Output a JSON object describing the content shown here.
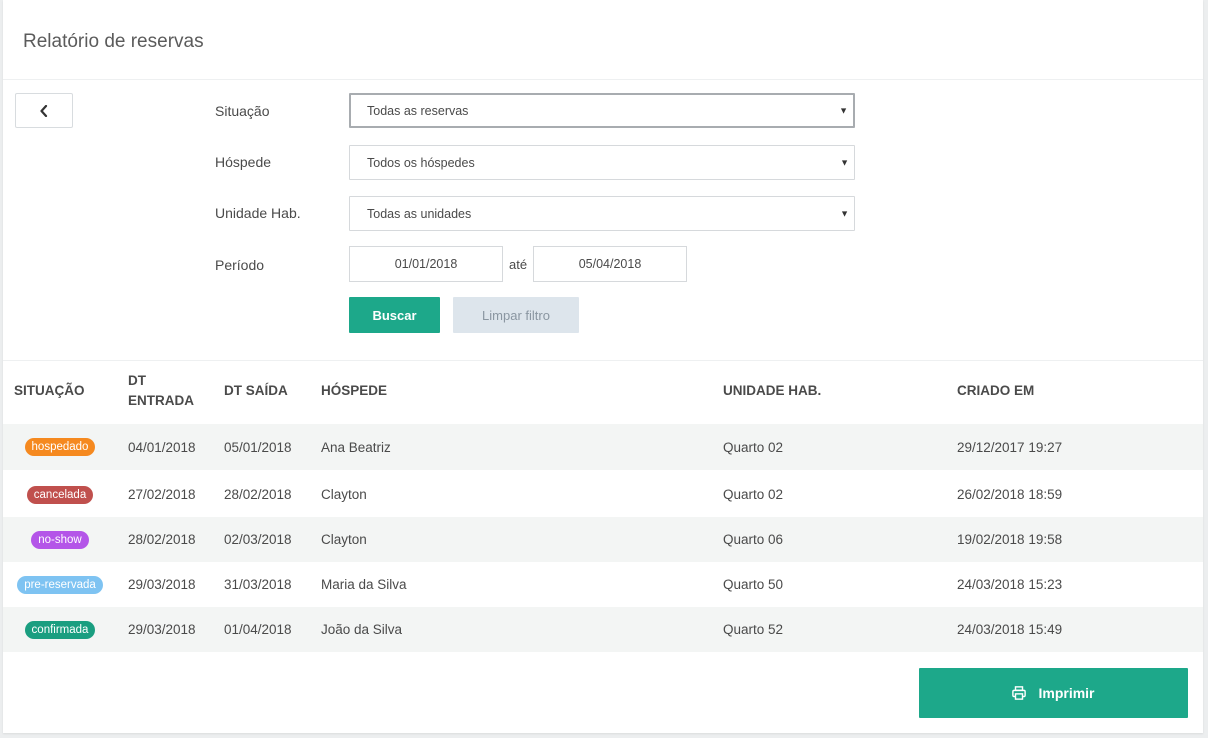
{
  "header": {
    "title": "Relatório de reservas"
  },
  "filters": {
    "situacao": {
      "label": "Situação",
      "value": "Todas as reservas"
    },
    "hospede": {
      "label": "Hóspede",
      "value": "Todos os hóspedes"
    },
    "unidade": {
      "label": "Unidade Hab.",
      "value": "Todas as unidades"
    },
    "periodo": {
      "label": "Período",
      "from": "01/01/2018",
      "separator": "até",
      "to": "05/04/2018"
    },
    "buscar_label": "Buscar",
    "limpar_label": "Limpar filtro"
  },
  "table": {
    "headers": {
      "situacao": "SITUAÇÃO",
      "dt_entrada_1": "DT",
      "dt_entrada_2": "ENTRADA",
      "dt_saida": "DT SAÍDA",
      "hospede": "HÓSPEDE",
      "unidade": "UNIDADE HAB.",
      "criado": "CRIADO EM"
    },
    "rows": [
      {
        "status": "hospedado",
        "status_color": "#f5891f",
        "entrada": "04/01/2018",
        "saida": "05/01/2018",
        "hospede": "Ana Beatriz",
        "unidade": "Quarto 02",
        "criado": "29/12/2017 19:27"
      },
      {
        "status": "cancelada",
        "status_color": "#c0504d",
        "entrada": "27/02/2018",
        "saida": "28/02/2018",
        "hospede": "Clayton",
        "unidade": "Quarto 02",
        "criado": "26/02/2018 18:59"
      },
      {
        "status": "no-show",
        "status_color": "#b455e8",
        "entrada": "28/02/2018",
        "saida": "02/03/2018",
        "hospede": "Clayton",
        "unidade": "Quarto 06",
        "criado": "19/02/2018 19:58"
      },
      {
        "status": "pre-reservada",
        "status_color": "#7ec3f2",
        "entrada": "29/03/2018",
        "saida": "31/03/2018",
        "hospede": "Maria da Silva",
        "unidade": "Quarto 50",
        "criado": "24/03/2018 15:23"
      },
      {
        "status": "confirmada",
        "status_color": "#1a9e80",
        "entrada": "29/03/2018",
        "saida": "01/04/2018",
        "hospede": "João da Silva",
        "unidade": "Quarto 52",
        "criado": "24/03/2018 15:49"
      }
    ]
  },
  "footer": {
    "print_label": "Imprimir",
    "print_icon": "printer-icon"
  },
  "colors": {
    "accent": "#1da88a",
    "secondary_button": "#dde5ec"
  }
}
